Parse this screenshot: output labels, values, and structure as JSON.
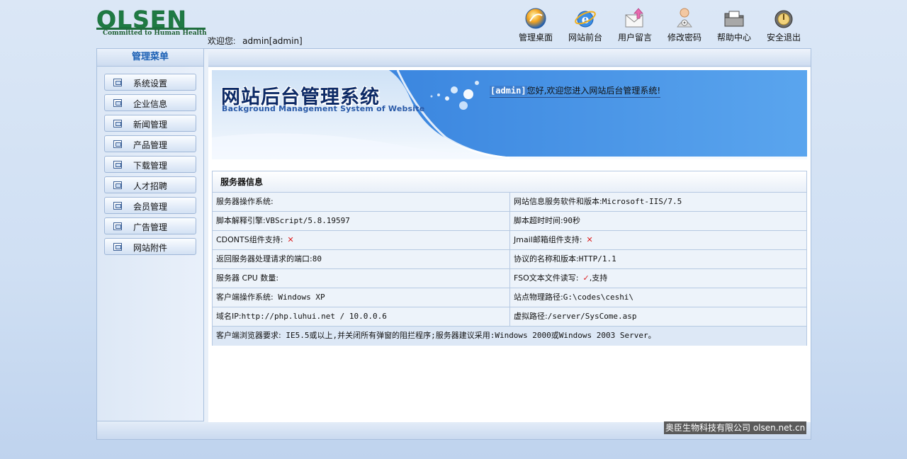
{
  "header": {
    "logo_text": "OLSEN",
    "logo_tagline": "Committed to Human Health",
    "welcome_label": "欢迎您:",
    "welcome_user": "admin[admin]",
    "nav": [
      {
        "label": "管理桌面",
        "icon": "desktop-icon"
      },
      {
        "label": "网站前台",
        "icon": "ie-browser-icon"
      },
      {
        "label": "用户留言",
        "icon": "message-envelope-icon"
      },
      {
        "label": "修改密码",
        "icon": "change-password-icon"
      },
      {
        "label": "帮助中心",
        "icon": "help-folder-icon"
      },
      {
        "label": "安全退出",
        "icon": "power-exit-icon"
      }
    ]
  },
  "sidebar": {
    "title": "管理菜单",
    "items": [
      {
        "label": "系统设置"
      },
      {
        "label": "企业信息"
      },
      {
        "label": "新闻管理"
      },
      {
        "label": "产品管理"
      },
      {
        "label": "下载管理"
      },
      {
        "label": "人才招聘"
      },
      {
        "label": "会员管理"
      },
      {
        "label": "广告管理"
      },
      {
        "label": "网站附件"
      }
    ]
  },
  "banner": {
    "title": "网站后台管理系统",
    "subtitle": "Background Management System of Website",
    "greeting_user": "[admin]",
    "greeting_text": "您好,欢迎您进入网站后台管理系统!"
  },
  "server_info": {
    "title": "服务器信息",
    "rows": [
      {
        "left": {
          "label": "服务器操作系统:",
          "value": ""
        },
        "right": {
          "label": "网站信息服务软件和版本:",
          "value": "Microsoft-IIS/7.5"
        }
      },
      {
        "left": {
          "label": "脚本解释引擎:",
          "value": "VBScript/5.8.19597"
        },
        "right": {
          "label": "脚本超时时间:",
          "value": "90秒"
        }
      },
      {
        "left": {
          "label": "CDONTS组件支持:",
          "value": "",
          "mark": "✕"
        },
        "right": {
          "label": "Jmail邮箱组件支持:",
          "value": "",
          "mark": "✕"
        }
      },
      {
        "left": {
          "label": "返回服务器处理请求的端口:",
          "value": "80"
        },
        "right": {
          "label": "协议的名称和版本:",
          "value": "HTTP/1.1"
        }
      },
      {
        "left": {
          "label": "服务器 CPU 数量:",
          "value": ""
        },
        "right": {
          "label": "FSO文本文件读写:",
          "value": ",支持",
          "mark": "✓"
        }
      },
      {
        "left": {
          "label": "客户端操作系统:",
          "value": " Windows XP"
        },
        "right": {
          "label": "站点物理路径:",
          "value": "G:\\codes\\ceshi\\"
        }
      },
      {
        "left": {
          "label": "域名IP:",
          "value": "http://php.luhui.net / 10.0.0.6"
        },
        "right": {
          "label": "虚拟路径:",
          "value": "/server/SysCome.asp"
        }
      }
    ],
    "footer_label": "客户端浏览器要求:",
    "footer_value": " IE5.5或以上,并关闭所有弹窗的阻拦程序;服务器建议采用:Windows 2000或Windows 2003 Server。"
  },
  "watermark": "奥臣生物科技有限公司 olsen.net.cn"
}
